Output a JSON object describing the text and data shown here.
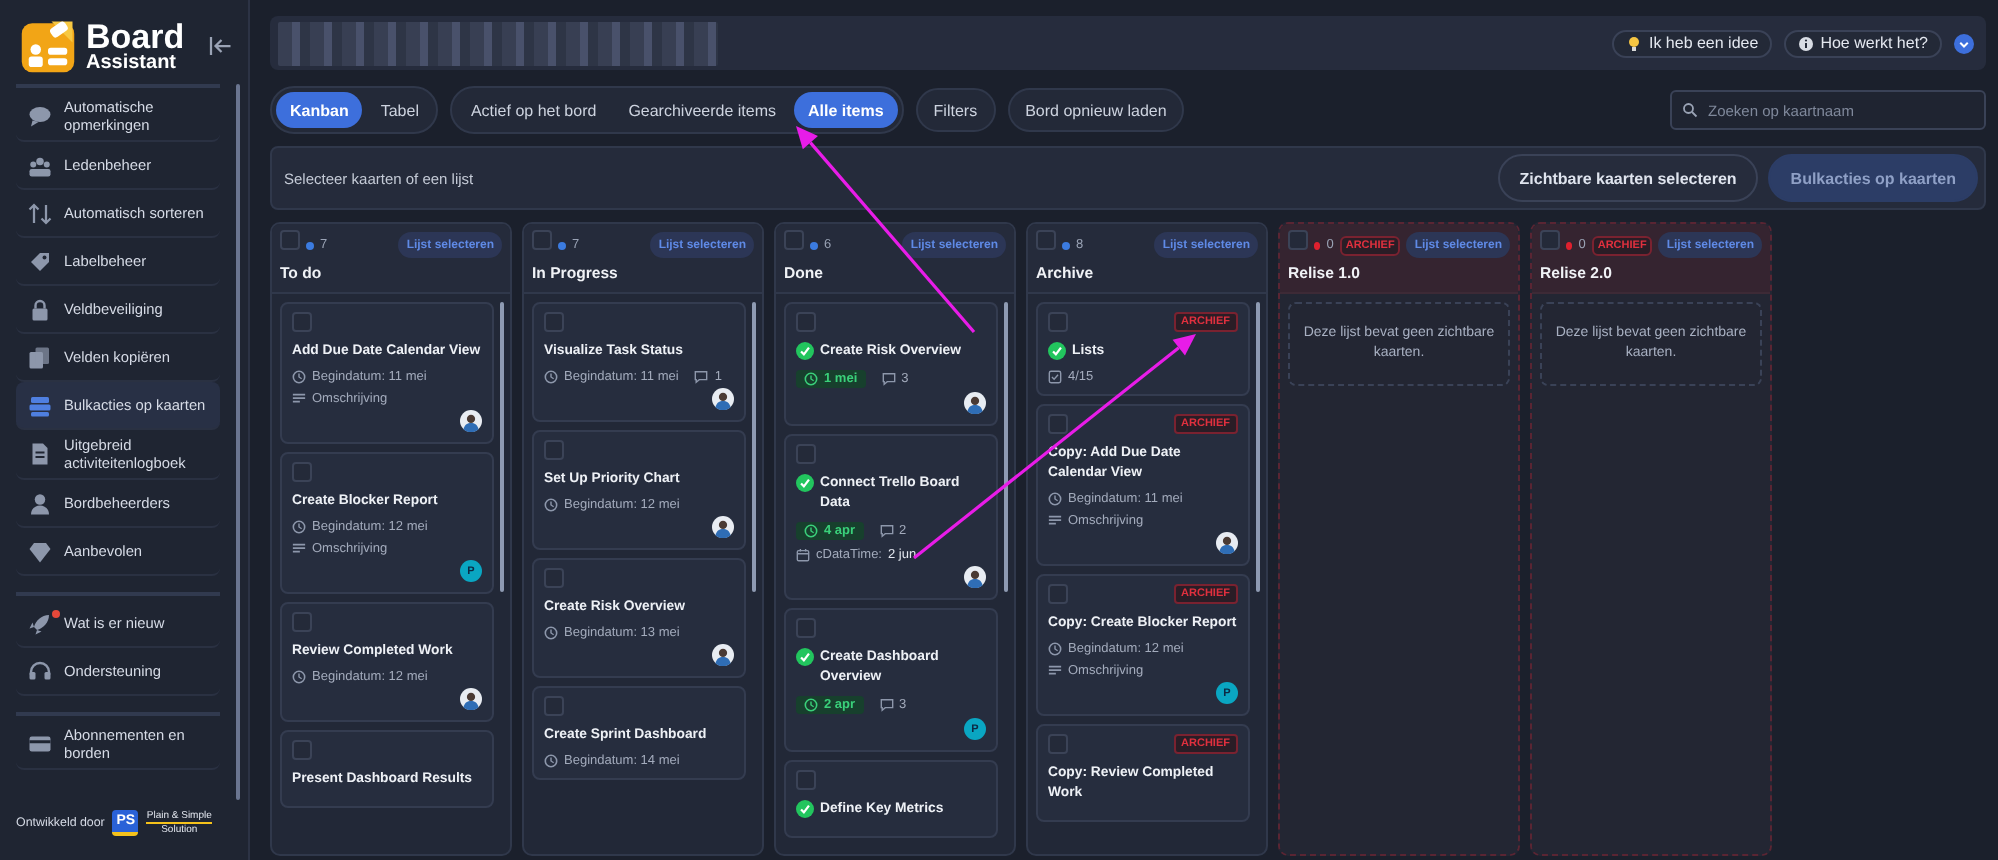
{
  "sidebar": {
    "brand": {
      "name": "Board",
      "subtitle": "Assistant"
    },
    "sections": [
      {
        "items": [
          {
            "label": "Automatische opmerkingen",
            "selected": false,
            "notification": false
          },
          {
            "label": "Ledenbeheer",
            "selected": false,
            "notification": false
          },
          {
            "label": "Automatisch sorteren",
            "selected": false,
            "notification": false
          },
          {
            "label": "Labelbeheer",
            "selected": false,
            "notification": false
          },
          {
            "label": "Veldbeveiliging",
            "selected": false,
            "notification": false
          },
          {
            "label": "Velden kopiëren",
            "selected": false,
            "notification": false
          },
          {
            "label": "Bulkacties op kaarten",
            "selected": true,
            "notification": false
          },
          {
            "label": "Uitgebreid activiteitenlogboek",
            "selected": false,
            "notification": false
          },
          {
            "label": "Bordbeheerders",
            "selected": false,
            "notification": false
          },
          {
            "label": "Aanbevolen",
            "selected": false,
            "notification": false
          }
        ]
      },
      {
        "items": [
          {
            "label": "Wat is er nieuw",
            "selected": false,
            "notification": true
          },
          {
            "label": "Ondersteuning",
            "selected": false,
            "notification": false
          }
        ]
      },
      {
        "items": [
          {
            "label": "Abonnementen en borden",
            "selected": false,
            "notification": false
          }
        ]
      }
    ],
    "footer": {
      "label": "Ontwikkeld door",
      "logo_mark": "PS",
      "logo_lines": [
        "Plain & Simple",
        "Solution"
      ]
    }
  },
  "header": {
    "buttons": [
      {
        "label": "Ik heb een idee",
        "kind": "idea"
      },
      {
        "label": "Hoe werkt het?",
        "kind": "info"
      }
    ]
  },
  "toolbar": {
    "view_tabs": [
      {
        "label": "Kanban",
        "selected": true
      },
      {
        "label": "Tabel",
        "selected": false
      }
    ],
    "filter_tabs": [
      {
        "label": "Actief op het bord",
        "selected": false
      },
      {
        "label": "Gearchiveerde items",
        "selected": false
      },
      {
        "label": "Alle items",
        "selected": true
      }
    ],
    "buttons": [
      "Filters",
      "Bord opnieuw laden"
    ],
    "search": {
      "placeholder": "Zoeken op kaartnaam"
    }
  },
  "bulk_bar": {
    "hint": "Selecteer kaarten of een lijst",
    "buttons": [
      {
        "label": "Zichtbare kaarten selecteren",
        "disabled": false
      },
      {
        "label": "Bulkacties op kaarten",
        "disabled": true
      }
    ]
  },
  "columns": [
    {
      "name": "To do",
      "checked": false,
      "count": "7",
      "color": "#3b7be0",
      "archived": false,
      "select_label": "Lijst selecteren",
      "cards": [
        {
          "title": "Add Due Date Calendar View",
          "checked": false,
          "done": false,
          "rows": [
            [
              {
                "kind": "start",
                "text": "Begindatum: 11 mei"
              }
            ],
            [
              {
                "kind": "description",
                "text": "Omschrijving"
              }
            ]
          ],
          "avatar": {
            "kind": "photo"
          }
        },
        {
          "title": "Create Blocker Report",
          "checked": false,
          "done": false,
          "rows": [
            [
              {
                "kind": "start",
                "text": "Begindatum: 12 mei"
              }
            ],
            [
              {
                "kind": "description",
                "text": "Omschrijving"
              }
            ]
          ],
          "avatar": {
            "kind": "letter",
            "text": "P"
          }
        },
        {
          "title": "Review Completed Work",
          "checked": false,
          "done": false,
          "rows": [
            [
              {
                "kind": "start",
                "text": "Begindatum: 12 mei"
              }
            ]
          ],
          "avatar": {
            "kind": "photo"
          }
        },
        {
          "title": "Present Dashboard Results",
          "checked": false,
          "done": false
        }
      ]
    },
    {
      "name": "In Progress",
      "checked": false,
      "count": "7",
      "color": "#3b7be0",
      "archived": false,
      "select_label": "Lijst selecteren",
      "cards": [
        {
          "title": "Visualize Task Status",
          "checked": false,
          "done": false,
          "rows": [
            [
              {
                "kind": "start",
                "text": "Begindatum: 11 mei"
              },
              {
                "kind": "comments",
                "text": "1"
              }
            ]
          ],
          "avatar": {
            "kind": "photo"
          }
        },
        {
          "title": "Set Up Priority Chart",
          "checked": false,
          "done": false,
          "rows": [
            [
              {
                "kind": "start",
                "text": "Begindatum: 12 mei"
              }
            ]
          ],
          "avatar": {
            "kind": "photo"
          }
        },
        {
          "title": "Create Risk Overview",
          "checked": false,
          "done": false,
          "rows": [
            [
              {
                "kind": "start",
                "text": "Begindatum: 13 mei"
              }
            ]
          ],
          "avatar": {
            "kind": "photo"
          }
        },
        {
          "title": "Create Sprint Dashboard",
          "checked": false,
          "done": false,
          "rows": [
            [
              {
                "kind": "start",
                "text": "Begindatum: 14 mei"
              }
            ]
          ]
        }
      ]
    },
    {
      "name": "Done",
      "checked": false,
      "count": "6",
      "color": "#3b7be0",
      "archived": false,
      "select_label": "Lijst selecteren",
      "cards": [
        {
          "title": "Create Risk Overview",
          "checked": false,
          "done": true,
          "rows": [
            [
              {
                "kind": "due",
                "text": "1 mei"
              },
              {
                "kind": "comments",
                "text": "3"
              }
            ]
          ],
          "avatar": {
            "kind": "photo"
          }
        },
        {
          "title": "Connect Trello Board Data",
          "checked": false,
          "done": true,
          "rows": [
            [
              {
                "kind": "due",
                "text": "4 apr"
              },
              {
                "kind": "comments",
                "text": "2"
              }
            ],
            [
              {
                "kind": "custom",
                "label": "cDataTime:",
                "value": "2 jun"
              }
            ]
          ],
          "avatar": {
            "kind": "photo"
          }
        },
        {
          "title": "Create Dashboard Overview",
          "checked": false,
          "done": true,
          "rows": [
            [
              {
                "kind": "due",
                "text": "2 apr"
              },
              {
                "kind": "comments",
                "text": "3"
              }
            ]
          ],
          "avatar": {
            "kind": "letter",
            "text": "P"
          }
        },
        {
          "title": "Define Key Metrics",
          "checked": false,
          "done": true
        }
      ]
    },
    {
      "name": "Archive",
      "checked": false,
      "count": "8",
      "color": "#3b7be0",
      "archived": false,
      "select_label": "Lijst selecteren",
      "cards": [
        {
          "title": "Lists",
          "checked": false,
          "done": true,
          "badge": "ARCHIEF",
          "rows": [
            [
              {
                "kind": "checklist",
                "text": "4/15"
              }
            ]
          ]
        },
        {
          "title": "Copy: Add Due Date Calendar View",
          "checked": false,
          "done": false,
          "badge": "ARCHIEF",
          "rows": [
            [
              {
                "kind": "start",
                "text": "Begindatum: 11 mei"
              }
            ],
            [
              {
                "kind": "description",
                "text": "Omschrijving"
              }
            ]
          ],
          "avatar": {
            "kind": "photo"
          }
        },
        {
          "title": "Copy: Create Blocker Report",
          "checked": false,
          "done": false,
          "badge": "ARCHIEF",
          "rows": [
            [
              {
                "kind": "start",
                "text": "Begindatum: 12 mei"
              }
            ],
            [
              {
                "kind": "description",
                "text": "Omschrijving"
              }
            ]
          ],
          "avatar": {
            "kind": "letter",
            "text": "P"
          }
        },
        {
          "title": "Copy: Review Completed Work",
          "checked": false,
          "done": false,
          "badge": "ARCHIEF"
        }
      ]
    },
    {
      "name": "Relise 1.0",
      "checked": false,
      "count": "0",
      "color": "#e0202e",
      "archived": true,
      "badge": "ARCHIEF",
      "select_label": "Lijst selecteren",
      "empty_text": "Deze lijst bevat geen zichtbare kaarten."
    },
    {
      "name": "Relise 2.0",
      "checked": false,
      "count": "0",
      "color": "#e0202e",
      "archived": true,
      "badge": "ARCHIEF",
      "select_label": "Lijst selecteren",
      "empty_text": "Deze lijst bevat geen zichtbare kaarten."
    }
  ]
}
